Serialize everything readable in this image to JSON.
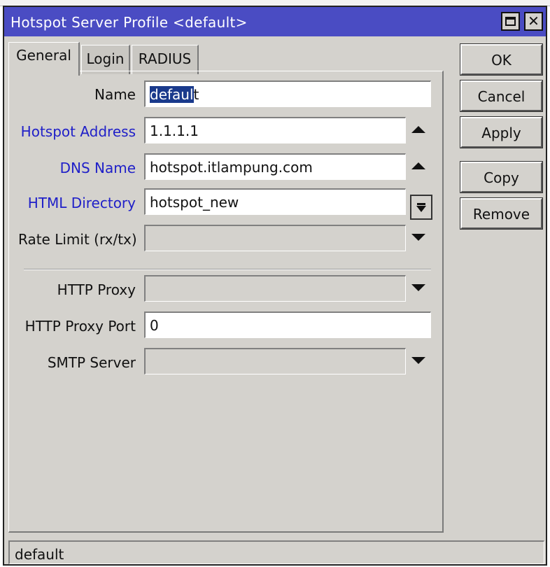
{
  "window": {
    "title": "Hotspot Server Profile <default>"
  },
  "tabs": [
    {
      "label": "General",
      "active": true
    },
    {
      "label": "Login",
      "active": false
    },
    {
      "label": "RADIUS",
      "active": false
    }
  ],
  "form": {
    "name": {
      "label": "Name",
      "value_selected": "defaul",
      "value_rest": "t"
    },
    "hotspot_address": {
      "label": "Hotspot Address",
      "value": "1.1.1.1"
    },
    "dns_name": {
      "label": "DNS Name",
      "value": "hotspot.itlampung.com"
    },
    "html_directory": {
      "label": "HTML Directory",
      "value": "hotspot_new"
    },
    "rate_limit": {
      "label": "Rate Limit (rx/tx)",
      "value": ""
    },
    "http_proxy": {
      "label": "HTTP Proxy",
      "value": ""
    },
    "http_proxy_port": {
      "label": "HTTP Proxy Port",
      "value": "0"
    },
    "smtp_server": {
      "label": "SMTP Server",
      "value": ""
    }
  },
  "buttons": {
    "ok": "OK",
    "cancel": "Cancel",
    "apply": "Apply",
    "copy": "Copy",
    "remove": "Remove"
  },
  "status": {
    "text": "default"
  },
  "colors": {
    "titlebar": "#4a4cc3",
    "window_bg": "#d4d2cd",
    "highlight_label": "#2020c8",
    "selection": "#1a3a8c"
  }
}
